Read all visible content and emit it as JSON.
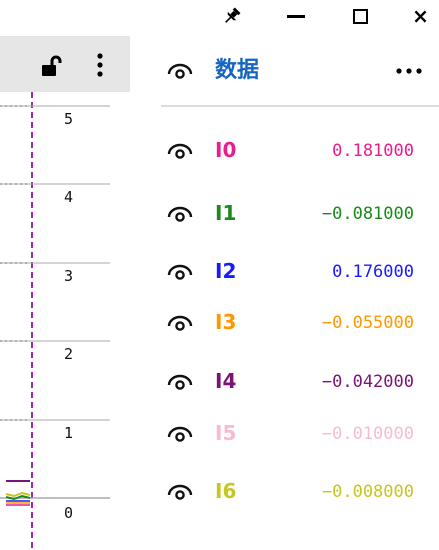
{
  "window_controls": {
    "pin_icon": "pin-icon",
    "minimize_icon": "minimize-icon",
    "maximize_icon": "maximize-icon",
    "close_icon": "close-icon",
    "close_glyph": "×"
  },
  "graph": {
    "toolbar_icons": [
      "lock-open-icon",
      "more-vertical-icon"
    ],
    "y_axis_labels": [
      "5",
      "4",
      "3",
      "2",
      "1",
      "0"
    ],
    "axis_color": "#9c27b0"
  },
  "algebra": {
    "title": "数据",
    "header_icons": [
      "eye-icon",
      "more-horizontal-icon"
    ],
    "title_color": "#1565c0",
    "rows": [
      {
        "name": "I0",
        "value": "0.181000",
        "color": "#e91e8c"
      },
      {
        "name": "I1",
        "value": "−0.081000",
        "color": "#1a8a1a"
      },
      {
        "name": "I2",
        "value": "0.176000",
        "color": "#1a1aff"
      },
      {
        "name": "I3",
        "value": "−0.055000",
        "color": "#ff9800"
      },
      {
        "name": "I4",
        "value": "−0.042000",
        "color": "#7b1475"
      },
      {
        "name": "I5",
        "value": "−0.010000",
        "color": "#f8bbd0"
      },
      {
        "name": "I6",
        "value": "−0.008000",
        "color": "#c6c620"
      }
    ]
  }
}
